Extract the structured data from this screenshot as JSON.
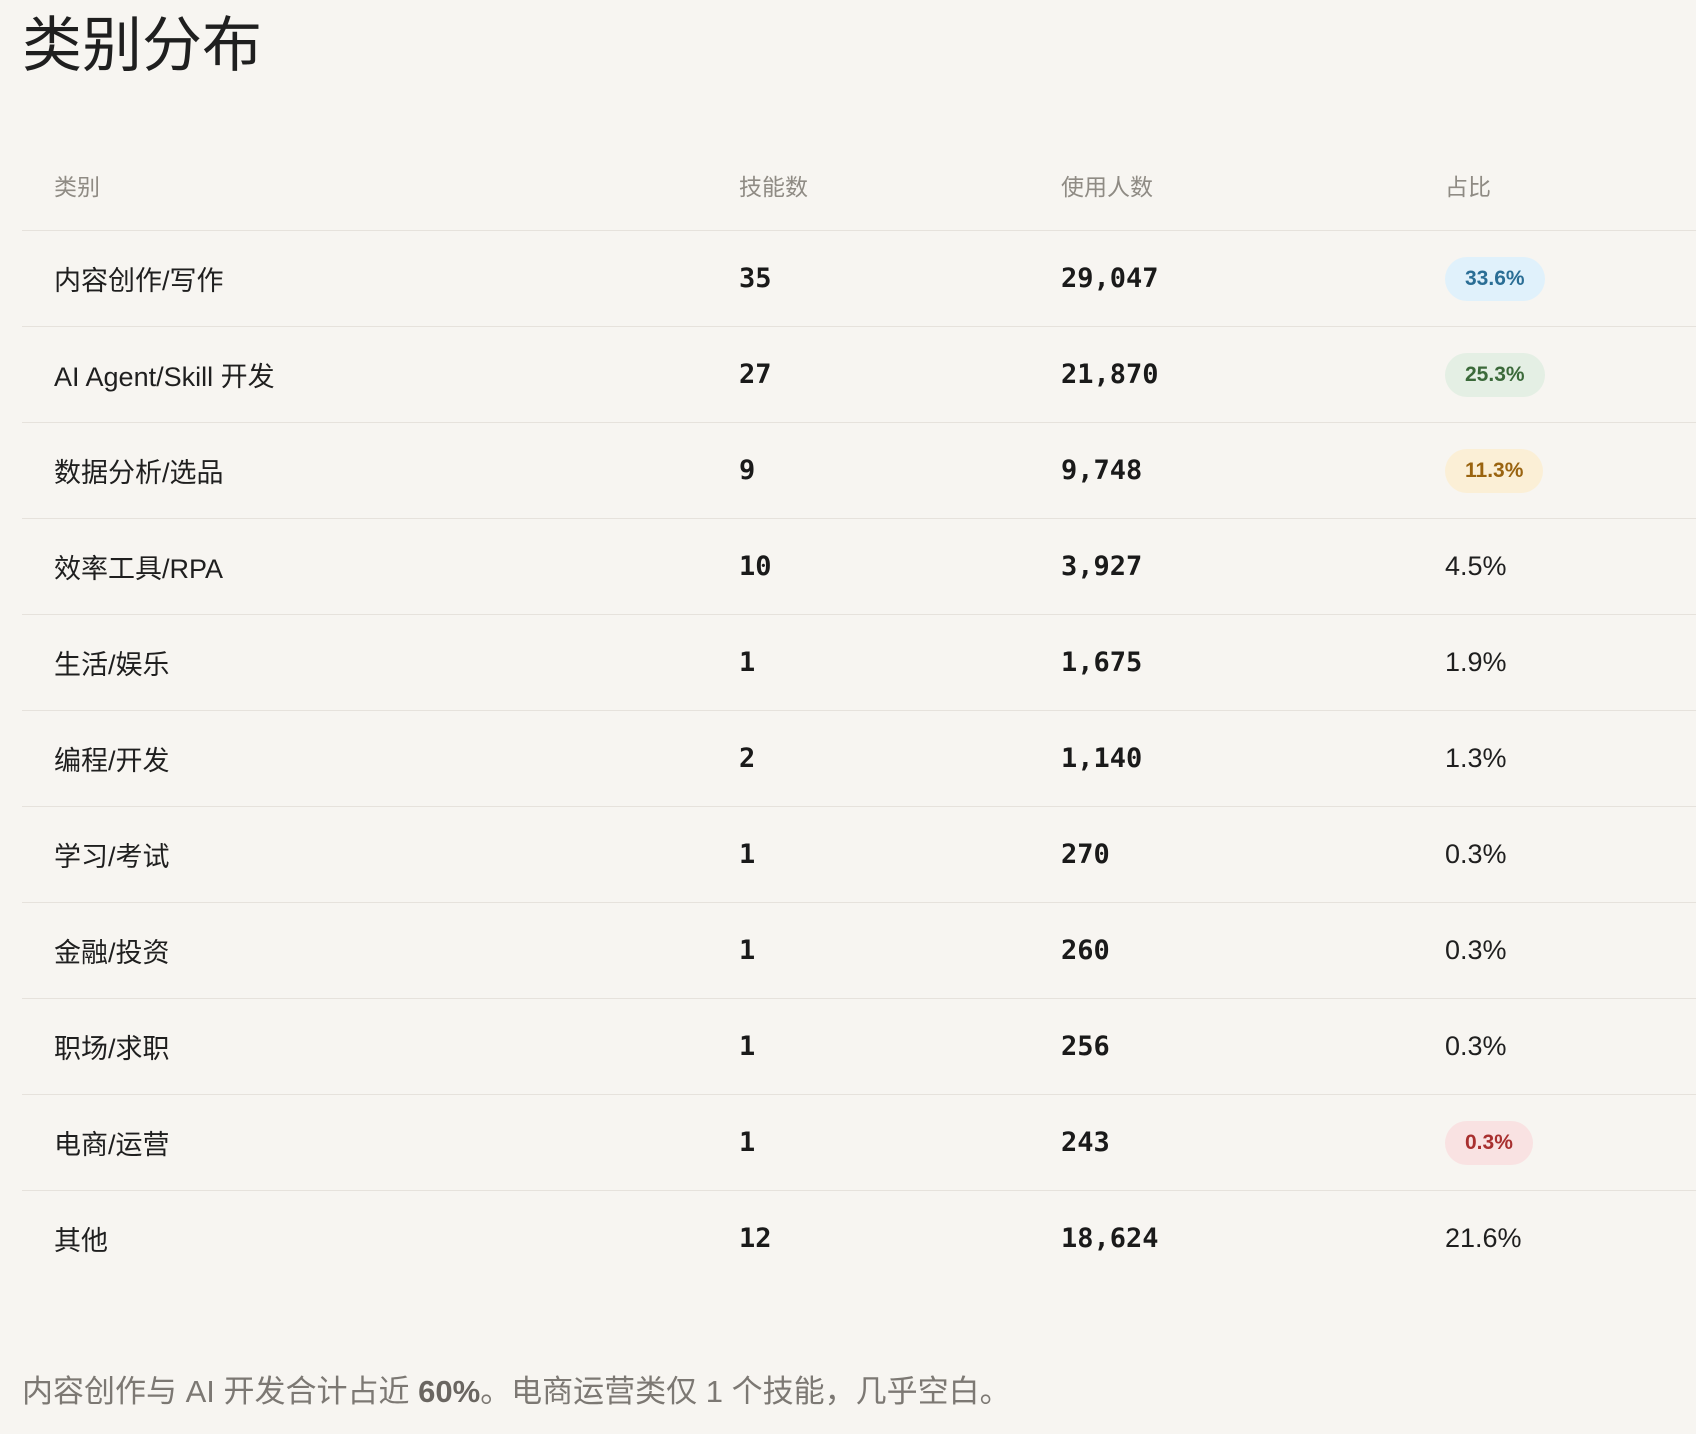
{
  "title": "类别分布",
  "table": {
    "headers": {
      "category": "类别",
      "skills": "技能数",
      "users": "使用人数",
      "share": "占比"
    },
    "rows": [
      {
        "category": "内容创作/写作",
        "skills": "35",
        "users": "29,047",
        "share": "33.6%",
        "highlight": "blue"
      },
      {
        "category": "AI Agent/Skill 开发",
        "skills": "27",
        "users": "21,870",
        "share": "25.3%",
        "highlight": "green"
      },
      {
        "category": "数据分析/选品",
        "skills": "9",
        "users": "9,748",
        "share": "11.3%",
        "highlight": "amber"
      },
      {
        "category": "效率工具/RPA",
        "skills": "10",
        "users": "3,927",
        "share": "4.5%",
        "highlight": ""
      },
      {
        "category": "生活/娱乐",
        "skills": "1",
        "users": "1,675",
        "share": "1.9%",
        "highlight": ""
      },
      {
        "category": "编程/开发",
        "skills": "2",
        "users": "1,140",
        "share": "1.3%",
        "highlight": ""
      },
      {
        "category": "学习/考试",
        "skills": "1",
        "users": "270",
        "share": "0.3%",
        "highlight": ""
      },
      {
        "category": "金融/投资",
        "skills": "1",
        "users": "260",
        "share": "0.3%",
        "highlight": ""
      },
      {
        "category": "职场/求职",
        "skills": "1",
        "users": "256",
        "share": "0.3%",
        "highlight": ""
      },
      {
        "category": "电商/运营",
        "skills": "1",
        "users": "243",
        "share": "0.3%",
        "highlight": "red"
      },
      {
        "category": "其他",
        "skills": "12",
        "users": "18,624",
        "share": "21.6%",
        "highlight": ""
      }
    ]
  },
  "footnote": {
    "before": "内容创作与 AI 开发合计占近 ",
    "emphasis": "60%",
    "after": "。电商运营类仅 1 个技能，几乎空白。"
  },
  "colors": {
    "background": "#f7f5f1",
    "pill_blue_bg": "#e0f1fb",
    "pill_green_bg": "#e4efe4",
    "pill_amber_bg": "#fbefd6",
    "pill_red_bg": "#f9e2e2"
  }
}
